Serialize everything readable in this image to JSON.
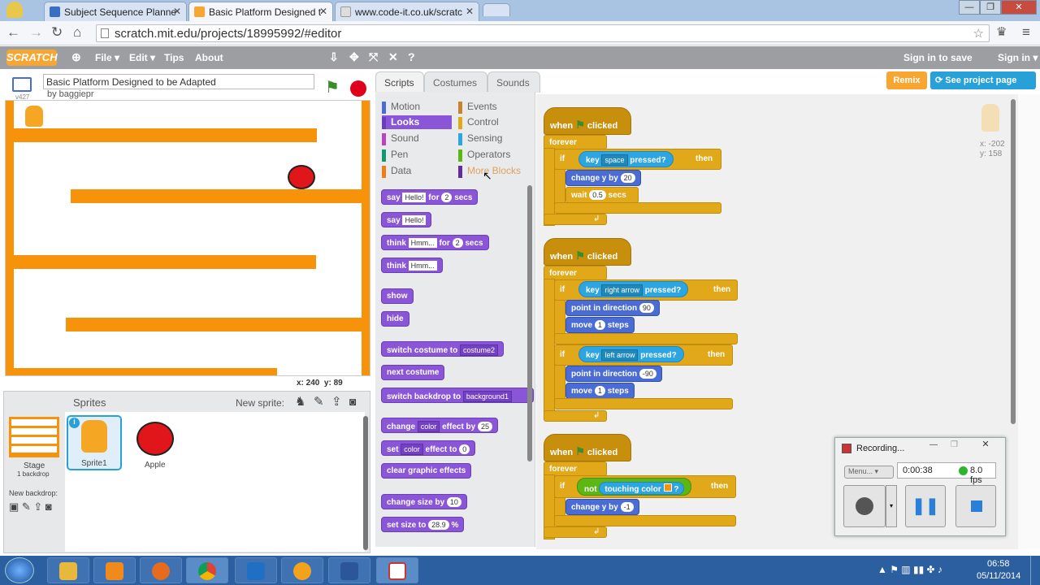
{
  "browser": {
    "tabs": [
      {
        "label": "Subject Sequence Planne"
      },
      {
        "label": "Basic Platform Designed t"
      },
      {
        "label": "www.code-it.co.uk/scratc"
      }
    ],
    "url": "scratch.mit.edu/projects/18995992/#editor"
  },
  "menubar": {
    "logo": "SCRATCH",
    "items": [
      "File ▾",
      "Edit ▾",
      "Tips",
      "About"
    ],
    "sign_in_to_save": "Sign in to save",
    "sign_in": "Sign in ▾"
  },
  "project": {
    "title": "Basic Platform Designed to be Adapted",
    "author": "by baggiepr",
    "version": "v427"
  },
  "stage": {
    "coords_x": "x: 240",
    "coords_y": "y: 89"
  },
  "sprites": {
    "header": "Sprites",
    "new_sprite": "New sprite:",
    "stage_label": "Stage",
    "stage_sub": "1 backdrop",
    "new_backdrop": "New backdrop:",
    "items": [
      {
        "name": "Sprite1"
      },
      {
        "name": "Apple"
      }
    ]
  },
  "tabs": {
    "scripts": "Scripts",
    "costumes": "Costumes",
    "sounds": "Sounds"
  },
  "actions": {
    "remix": "Remix",
    "see_project": "See project page"
  },
  "categories": [
    {
      "name": "Motion",
      "color": "#4a6cd4"
    },
    {
      "name": "Looks",
      "color": "#8a55d7"
    },
    {
      "name": "Sound",
      "color": "#bb42c3"
    },
    {
      "name": "Pen",
      "color": "#0e9a6c"
    },
    {
      "name": "Data",
      "color": "#ee7d16"
    },
    {
      "name": "Events",
      "color": "#c88330"
    },
    {
      "name": "Control",
      "color": "#e1a91a"
    },
    {
      "name": "Sensing",
      "color": "#2ca5e2"
    },
    {
      "name": "Operators",
      "color": "#5cb712"
    },
    {
      "name": "More Blocks",
      "color": "#632d99"
    }
  ],
  "palette": {
    "say": "say",
    "hello": "Hello!",
    "for": "for",
    "secs": "secs",
    "two": "2",
    "think": "think",
    "hmm": "Hmm...",
    "show": "show",
    "hide": "hide",
    "switch_costume": "switch costume to",
    "costume2": "costume2",
    "next_costume": "next costume",
    "switch_backdrop": "switch backdrop to",
    "backdrop1": "background1",
    "change": "change",
    "color": "color",
    "effect_by": "effect by",
    "v25": "25",
    "set": "set",
    "effect_to": "effect to",
    "v0": "0",
    "clear_effects": "clear graphic effects",
    "change_size": "change size by",
    "v10": "10",
    "set_size": "set size to",
    "v289": "28.9",
    "pct": "%"
  },
  "scripts": {
    "when": "when",
    "clicked": "clicked",
    "forever": "forever",
    "if": "if",
    "then": "then",
    "key": "key",
    "pressed": "pressed?",
    "space": "space",
    "right": "right arrow",
    "left": "left arrow",
    "change_y": "change y by",
    "v20": "20",
    "wait": "wait",
    "v05": "0.5",
    "secs": "secs",
    "point": "point in direction",
    "v90": "90",
    "vm90": "-90",
    "move": "move",
    "v1": "1",
    "steps": "steps",
    "not": "not",
    "touching": "touching color",
    "q": "?",
    "vm1": "-1",
    "sprite_x": "x: -202",
    "sprite_y": "y: 158"
  },
  "recording": {
    "title": "Recording...",
    "menu": "Menu...",
    "time": "0:00:38",
    "fps": "8.0 fps"
  },
  "taskbar": {
    "time": "06:58",
    "date": "05/11/2014"
  }
}
